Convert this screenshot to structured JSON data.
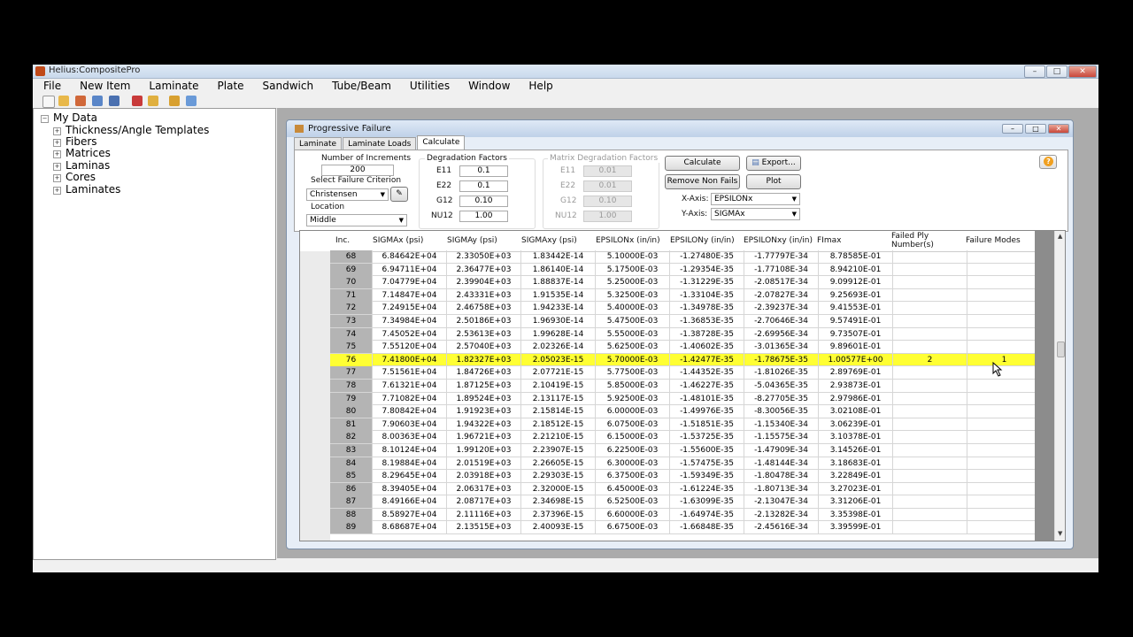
{
  "app": {
    "title": "Helius:CompositePro"
  },
  "menu": [
    "File",
    "New Item",
    "Laminate",
    "Plate",
    "Sandwich",
    "Tube/Beam",
    "Utilities",
    "Window",
    "Help"
  ],
  "tree": {
    "root": "My Data",
    "items": [
      "Thickness/Angle Templates",
      "Fibers",
      "Matrices",
      "Laminas",
      "Cores",
      "Laminates"
    ]
  },
  "window": {
    "title": "Progressive Failure"
  },
  "tabs": [
    "Laminate",
    "Laminate Loads",
    "Calculate"
  ],
  "form": {
    "num_increments_label": "Number of Increments",
    "num_increments": "200",
    "failure_criterion_label": "Select Failure Criterion",
    "failure_criterion": "Christensen",
    "location_label": "Location",
    "location": "Middle",
    "degradation_label": "Degradation Factors",
    "deg": {
      "E11_label": "E11",
      "E11": "0.1",
      "E22_label": "E22",
      "E22": "0.1",
      "G12_label": "G12",
      "G12": "0.10",
      "NU12_label": "NU12",
      "NU12": "1.00"
    },
    "matrix_degradation_label": "Matrix Degradation Factors",
    "mdeg": {
      "E11_label": "E11",
      "E11": "0.01",
      "E22_label": "E22",
      "E22": "0.01",
      "G12_label": "G12",
      "G12": "0.10",
      "NU12_label": "NU12",
      "NU12": "1.00"
    },
    "calculate_label": "Calculate",
    "export_label": "Export...",
    "remove_label": "Remove Non Fails",
    "plot_label": "Plot",
    "xaxis_label": "X-Axis:",
    "xaxis": "EPSILONx",
    "yaxis_label": "Y-Axis:",
    "yaxis": "SIGMAx"
  },
  "grid": {
    "headers": [
      "Inc.",
      "SIGMAx (psi)",
      "SIGMAy (psi)",
      "SIGMAxy (psi)",
      "EPSILONx (in/in)",
      "EPSILONy (in/in)",
      "EPSILONxy (in/in)",
      "FImax",
      "Failed Ply Number(s)",
      "Failure Modes"
    ],
    "rows": [
      [
        "68",
        "6.84642E+04",
        "2.33050E+03",
        "1.83442E-14",
        "5.10000E-03",
        "-1.27480E-35",
        "-1.77797E-34",
        "8.78585E-01",
        "",
        ""
      ],
      [
        "69",
        "6.94711E+04",
        "2.36477E+03",
        "1.86140E-14",
        "5.17500E-03",
        "-1.29354E-35",
        "-1.77108E-34",
        "8.94210E-01",
        "",
        ""
      ],
      [
        "70",
        "7.04779E+04",
        "2.39904E+03",
        "1.88837E-14",
        "5.25000E-03",
        "-1.31229E-35",
        "-2.08517E-34",
        "9.09912E-01",
        "",
        ""
      ],
      [
        "71",
        "7.14847E+04",
        "2.43331E+03",
        "1.91535E-14",
        "5.32500E-03",
        "-1.33104E-35",
        "-2.07827E-34",
        "9.25693E-01",
        "",
        ""
      ],
      [
        "72",
        "7.24915E+04",
        "2.46758E+03",
        "1.94233E-14",
        "5.40000E-03",
        "-1.34978E-35",
        "-2.39237E-34",
        "9.41553E-01",
        "",
        ""
      ],
      [
        "73",
        "7.34984E+04",
        "2.50186E+03",
        "1.96930E-14",
        "5.47500E-03",
        "-1.36853E-35",
        "-2.70646E-34",
        "9.57491E-01",
        "",
        ""
      ],
      [
        "74",
        "7.45052E+04",
        "2.53613E+03",
        "1.99628E-14",
        "5.55000E-03",
        "-1.38728E-35",
        "-2.69956E-34",
        "9.73507E-01",
        "",
        ""
      ],
      [
        "75",
        "7.55120E+04",
        "2.57040E+03",
        "2.02326E-14",
        "5.62500E-03",
        "-1.40602E-35",
        "-3.01365E-34",
        "9.89601E-01",
        "",
        ""
      ],
      [
        "76",
        "7.41800E+04",
        "1.82327E+03",
        "2.05023E-15",
        "5.70000E-03",
        "-1.42477E-35",
        "-1.78675E-35",
        "1.00577E+00",
        "2",
        "1"
      ],
      [
        "77",
        "7.51561E+04",
        "1.84726E+03",
        "2.07721E-15",
        "5.77500E-03",
        "-1.44352E-35",
        "-1.81026E-35",
        "2.89769E-01",
        "",
        ""
      ],
      [
        "78",
        "7.61321E+04",
        "1.87125E+03",
        "2.10419E-15",
        "5.85000E-03",
        "-1.46227E-35",
        "-5.04365E-35",
        "2.93873E-01",
        "",
        ""
      ],
      [
        "79",
        "7.71082E+04",
        "1.89524E+03",
        "2.13117E-15",
        "5.92500E-03",
        "-1.48101E-35",
        "-8.27705E-35",
        "2.97986E-01",
        "",
        ""
      ],
      [
        "80",
        "7.80842E+04",
        "1.91923E+03",
        "2.15814E-15",
        "6.00000E-03",
        "-1.49976E-35",
        "-8.30056E-35",
        "3.02108E-01",
        "",
        ""
      ],
      [
        "81",
        "7.90603E+04",
        "1.94322E+03",
        "2.18512E-15",
        "6.07500E-03",
        "-1.51851E-35",
        "-1.15340E-34",
        "3.06239E-01",
        "",
        ""
      ],
      [
        "82",
        "8.00363E+04",
        "1.96721E+03",
        "2.21210E-15",
        "6.15000E-03",
        "-1.53725E-35",
        "-1.15575E-34",
        "3.10378E-01",
        "",
        ""
      ],
      [
        "83",
        "8.10124E+04",
        "1.99120E+03",
        "2.23907E-15",
        "6.22500E-03",
        "-1.55600E-35",
        "-1.47909E-34",
        "3.14526E-01",
        "",
        ""
      ],
      [
        "84",
        "8.19884E+04",
        "2.01519E+03",
        "2.26605E-15",
        "6.30000E-03",
        "-1.57475E-35",
        "-1.48144E-34",
        "3.18683E-01",
        "",
        ""
      ],
      [
        "85",
        "8.29645E+04",
        "2.03918E+03",
        "2.29303E-15",
        "6.37500E-03",
        "-1.59349E-35",
        "-1.80478E-34",
        "3.22849E-01",
        "",
        ""
      ],
      [
        "86",
        "8.39405E+04",
        "2.06317E+03",
        "2.32000E-15",
        "6.45000E-03",
        "-1.61224E-35",
        "-1.80713E-34",
        "3.27023E-01",
        "",
        ""
      ],
      [
        "87",
        "8.49166E+04",
        "2.08717E+03",
        "2.34698E-15",
        "6.52500E-03",
        "-1.63099E-35",
        "-2.13047E-34",
        "3.31206E-01",
        "",
        ""
      ],
      [
        "88",
        "8.58927E+04",
        "2.11116E+03",
        "2.37396E-15",
        "6.60000E-03",
        "-1.64974E-35",
        "-2.13282E-34",
        "3.35398E-01",
        "",
        ""
      ],
      [
        "89",
        "8.68687E+04",
        "2.13515E+03",
        "2.40093E-15",
        "6.67500E-03",
        "-1.66848E-35",
        "-2.45616E-34",
        "3.39599E-01",
        "",
        ""
      ]
    ],
    "selected_row": 8
  },
  "colors": {
    "selected_row": "#ffff33",
    "accent": "#f0a020"
  }
}
